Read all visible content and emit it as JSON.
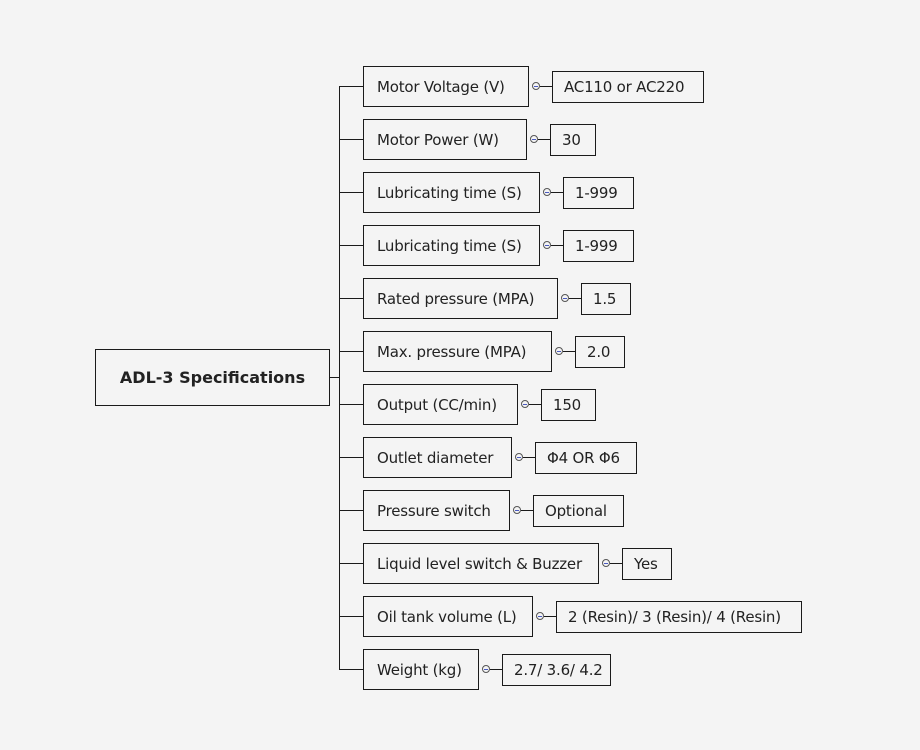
{
  "diagram": {
    "type": "mind-map",
    "root": {
      "label": "ADL-3 Specifications"
    },
    "branches": [
      {
        "label": "Motor Voltage (V)",
        "value": "AC110 or AC220"
      },
      {
        "label": "Motor Power (W)",
        "value": "30"
      },
      {
        "label": "Lubricating time (S)",
        "value": "1-999"
      },
      {
        "label": "Lubricating time (S)",
        "value": "1-999"
      },
      {
        "label": "Rated pressure (MPA)",
        "value": "1.5"
      },
      {
        "label": "Max. pressure (MPA)",
        "value": "2.0"
      },
      {
        "label": "Output (CC/min)",
        "value": "150"
      },
      {
        "label": "Outlet diameter",
        "value": "Φ4 OR Φ6"
      },
      {
        "label": "Pressure switch",
        "value": "Optional"
      },
      {
        "label": "Liquid level switch & Buzzer",
        "value": "Yes"
      },
      {
        "label": "Oil tank volume (L)",
        "value": "2 (Resin)/ 3 (Resin)/ 4 (Resin)"
      },
      {
        "label": "Weight (kg)",
        "value": "2.7/ 3.6/ 4.2"
      }
    ],
    "collapse_icon": "collapse-minus-icon"
  }
}
